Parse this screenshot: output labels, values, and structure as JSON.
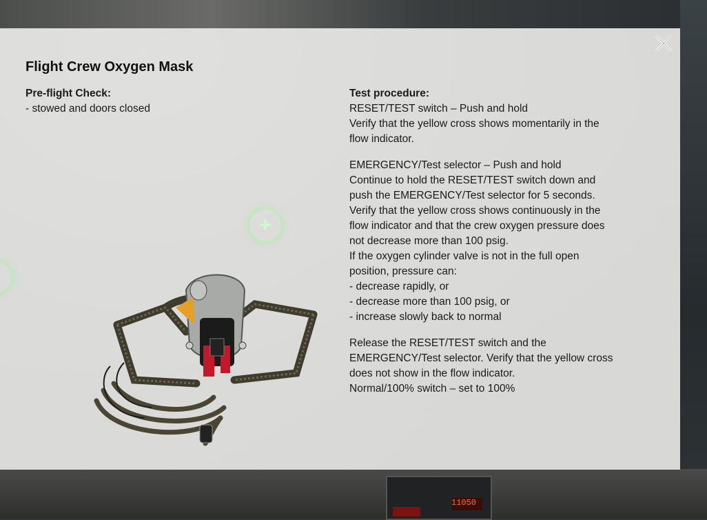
{
  "background": {
    "led_display": "11050"
  },
  "modal": {
    "title": "Flight Crew Oxygen Mask",
    "close_icon": "close-icon",
    "preflight": {
      "heading": "Pre-flight Check:",
      "lines": [
        "- stowed and doors closed"
      ]
    },
    "test": {
      "heading": "Test procedure:",
      "para1": [
        "RESET/TEST switch – Push and hold",
        "Verify that the yellow cross shows momentarily in the",
        "flow indicator."
      ],
      "para2": [
        "EMERGENCY/Test selector – Push and hold",
        "Continue to hold the RESET/TEST switch down and",
        "push the EMERGENCY/Test selector for 5 seconds.",
        "Verify that the yellow cross shows continuously in the",
        "flow indicator and that the crew oxygen pressure does",
        "not decrease more than 100 psig.",
        "If the oxygen cylinder valve is not in the full open",
        "position, pressure can:",
        "- decrease rapidly, or",
        "- decrease more than 100 psig, or",
        "- increase slowly back to normal"
      ],
      "para3": [
        "Release the RESET/TEST switch and the",
        "EMERGENCY/Test selector. Verify that the yellow cross",
        "does not show in the flow indicator.",
        "Normal/100% switch – set to 100%"
      ]
    },
    "image_icon": "oxygen-mask-image"
  },
  "hotspots": [
    {
      "icon": "plus-icon",
      "label": "+"
    }
  ],
  "colors": {
    "modal_bg": "#ecece9",
    "text": "#1a1a1a",
    "hotspot": "#b4f0aa"
  }
}
